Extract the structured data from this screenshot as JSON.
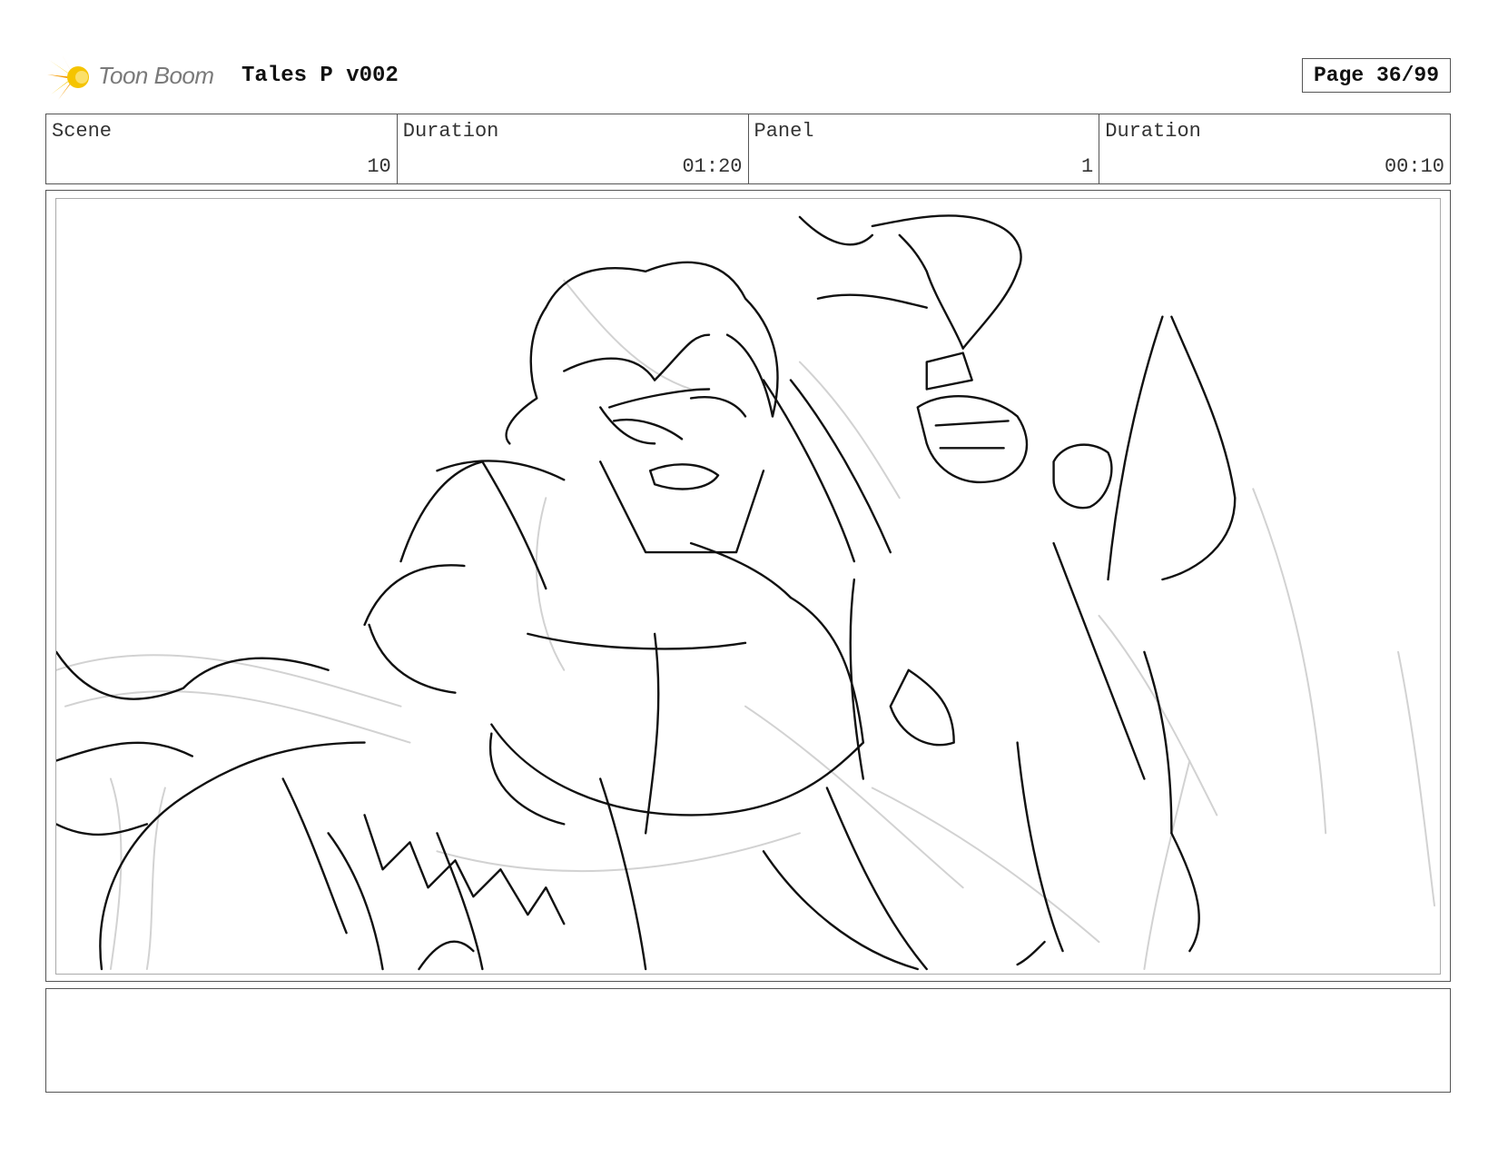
{
  "header": {
    "logo_text": "Toon Boom",
    "project_title": "Tales P v002",
    "page_label": "Page 36/99"
  },
  "info": {
    "scene_label": "Scene",
    "scene_value": "10",
    "duration_label": "Duration",
    "duration_value": "01:20",
    "panel_label": "Panel",
    "panel_value": "1",
    "panel_duration_label": "Duration",
    "panel_duration_value": "00:10"
  },
  "panel": {
    "image_description": "storyboard-sketch"
  },
  "notes": {
    "text": ""
  },
  "colors": {
    "logo_yellow": "#f5c400",
    "logo_orange": "#f59a00",
    "border": "#555555",
    "sketch_line": "#111111",
    "sketch_rough": "#cfcfcf"
  }
}
